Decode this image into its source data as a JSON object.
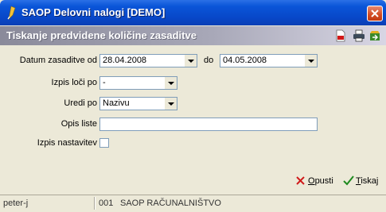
{
  "window": {
    "title": "SAOP Delovni nalogi [DEMO]"
  },
  "header": {
    "title": "Tiskanje predvidene količine zasaditve"
  },
  "toolbar": {
    "icons": [
      "pdf-icon",
      "printer-icon",
      "export-icon"
    ]
  },
  "form": {
    "date_from_label": "Datum zasaditve od",
    "date_from_value": "28.04.2008",
    "date_to_label": "do",
    "date_to_value": "04.05.2008",
    "split_label": "Izpis loči po",
    "split_value": "-",
    "sort_label": "Uredi po",
    "sort_value": "Nazivu",
    "desc_label": "Opis liste",
    "desc_value": "",
    "instr_label": "Izpis nastavitev",
    "instr_checked": false
  },
  "buttons": {
    "cancel_label": "Opusti",
    "print_label": "Tiskaj"
  },
  "status": {
    "user": "peter-j",
    "code": "001",
    "company": "SAOP RAČUNALNIŠTVO"
  }
}
